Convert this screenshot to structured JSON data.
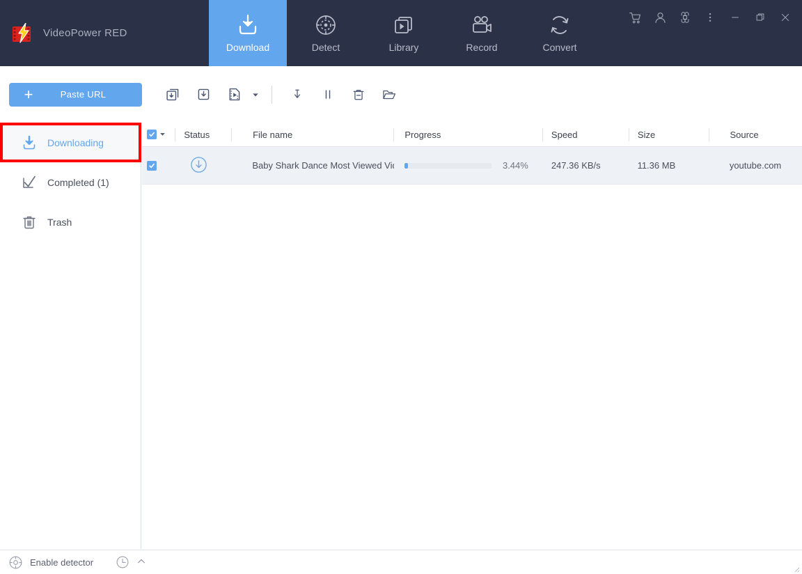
{
  "app": {
    "title": "VideoPower RED",
    "logo_icon": "lightning-film-icon"
  },
  "nav": {
    "tabs": [
      {
        "label": "Download",
        "icon": "download-tray-icon",
        "active": true
      },
      {
        "label": "Detect",
        "icon": "radar-detect-icon",
        "active": false
      },
      {
        "label": "Library",
        "icon": "media-library-icon",
        "active": false
      },
      {
        "label": "Record",
        "icon": "video-camera-icon",
        "active": false
      },
      {
        "label": "Convert",
        "icon": "convert-arrows-icon",
        "active": false
      }
    ]
  },
  "window_controls": [
    {
      "name": "cart-icon",
      "tooltip": "Cart"
    },
    {
      "name": "account-icon",
      "tooltip": "Account"
    },
    {
      "name": "apps-grid-icon",
      "tooltip": "Apps"
    },
    {
      "name": "more-options-icon",
      "tooltip": "More"
    },
    {
      "name": "minimize-icon",
      "tooltip": "Minimize"
    },
    {
      "name": "restore-icon",
      "tooltip": "Restore"
    },
    {
      "name": "close-icon",
      "tooltip": "Close"
    }
  ],
  "toolbar": {
    "paste_url_label": "Paste URL",
    "buttons": [
      {
        "name": "download-all-icon"
      },
      {
        "name": "download-single-icon"
      },
      {
        "name": "video-download-icon"
      },
      {
        "name": "video-download-caret-icon"
      },
      {
        "name": "start-download-icon"
      },
      {
        "name": "pause-download-icon"
      },
      {
        "name": "delete-download-icon"
      },
      {
        "name": "open-folder-icon"
      }
    ]
  },
  "sidebar": {
    "items": [
      {
        "label": "Downloading",
        "icon": "download-icon",
        "active": true
      },
      {
        "label": "Completed (1)",
        "icon": "check-mark-icon",
        "active": false
      },
      {
        "label": "Trash",
        "icon": "trash-icon",
        "active": false
      }
    ]
  },
  "table": {
    "headers": {
      "status": "Status",
      "file_name": "File name",
      "progress": "Progress",
      "speed": "Speed",
      "size": "Size",
      "source": "Source"
    },
    "select_all_checked": true,
    "rows": [
      {
        "checked": true,
        "status_icon": "downloading-circle-arrow-icon",
        "file_name": "Baby Shark Dance  Most Viewed Vide...",
        "progress_percent": "3.44%",
        "progress_value": 3.44,
        "speed": "247.36 KB/s",
        "size": "11.36 MB",
        "source": "youtube.com"
      }
    ]
  },
  "status_bar": {
    "detector_icon": "detector-crosshair-icon",
    "detector_label": "Enable detector",
    "history_icon": "clock-history-icon",
    "expand_icon": "chevron-up-icon"
  },
  "colors": {
    "header_bg": "#2b3147",
    "accent_blue": "#62a6ee",
    "row_highlight": "#eef2f7",
    "annotation_red": "#ff0000",
    "sidebar_active_bg": "#f6f8fa"
  }
}
